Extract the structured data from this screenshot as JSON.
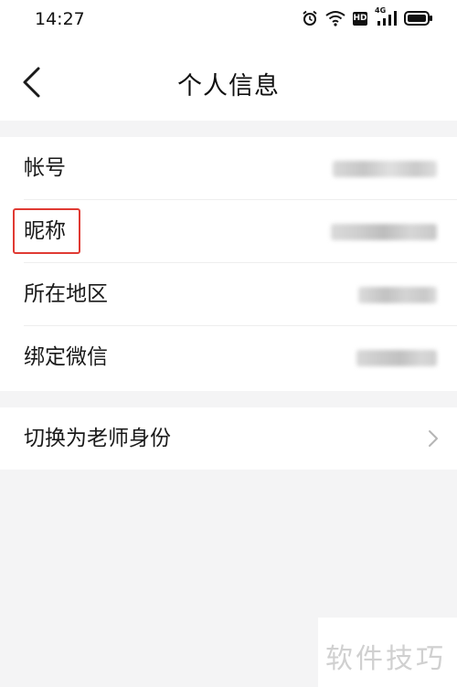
{
  "status_bar": {
    "time": "14:27",
    "icons": [
      "alarm-icon",
      "wifi-icon",
      "hd-icon",
      "signal-4g-icon",
      "battery-icon"
    ],
    "hd_label": "HD",
    "network_label": "4G"
  },
  "nav": {
    "title": "个人信息",
    "back_icon": "chevron-left-icon"
  },
  "info_rows": [
    {
      "label": "帐号"
    },
    {
      "label": "昵称"
    },
    {
      "label": "所在地区"
    },
    {
      "label": "绑定微信"
    }
  ],
  "switch_row": {
    "label": "切换为老师身份",
    "icon": "chevron-right-icon"
  },
  "watermark": {
    "text": "软件技巧"
  },
  "colors": {
    "background": "#f4f4f5",
    "card": "#ffffff",
    "highlight": "#e03a33",
    "chevron": "#b5b5b5"
  }
}
